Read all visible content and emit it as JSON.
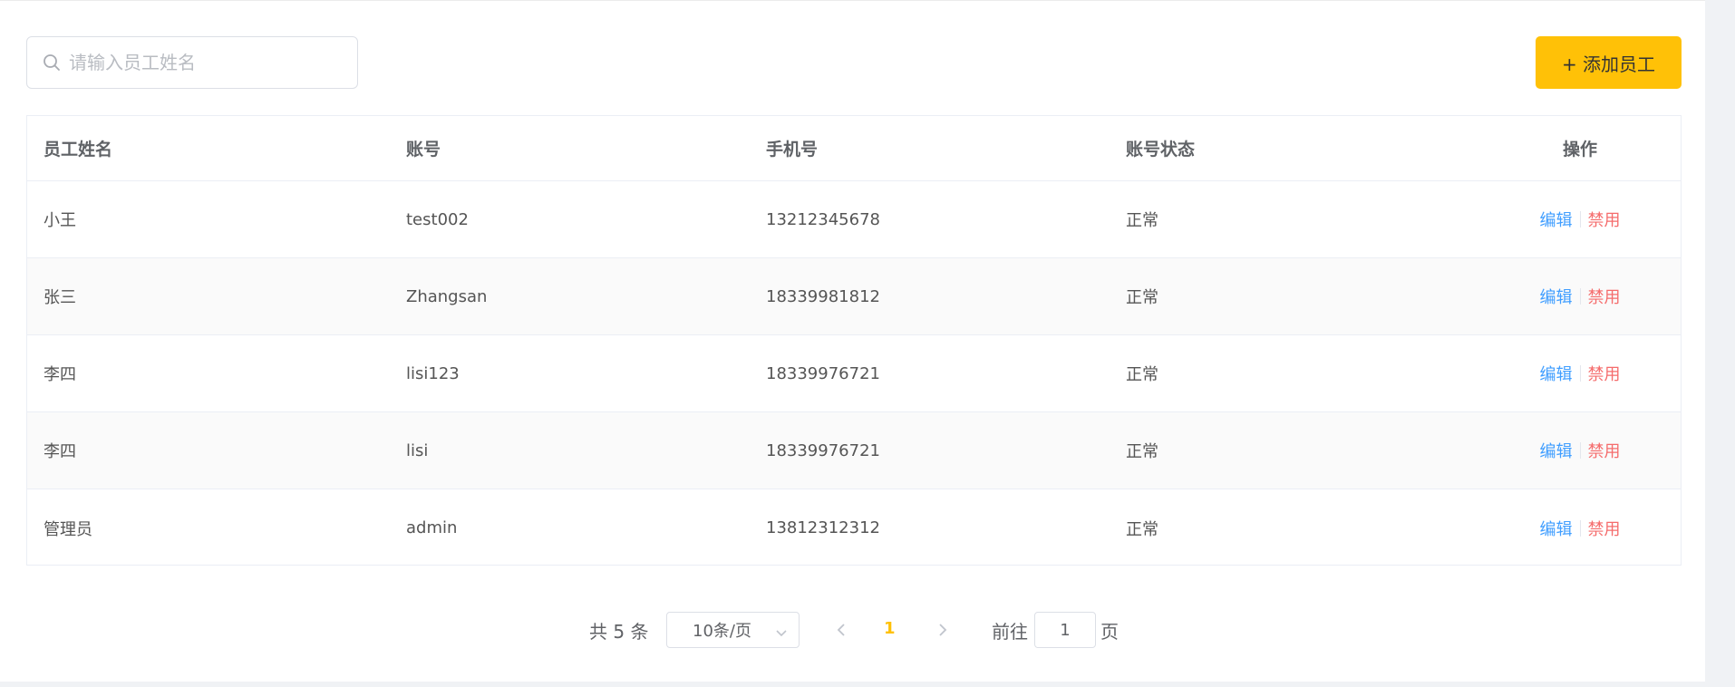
{
  "toolbar": {
    "search_placeholder": "请输入员工姓名",
    "add_label": "+ 添加员工"
  },
  "table": {
    "headers": {
      "name": "员工姓名",
      "account": "账号",
      "phone": "手机号",
      "status": "账号状态",
      "ops": "操作"
    },
    "rows": [
      {
        "name": "小王",
        "account": "test002",
        "phone": "13212345678",
        "status": "正常",
        "edit": "编辑",
        "disable": "禁用"
      },
      {
        "name": "张三",
        "account": "Zhangsan",
        "phone": "18339981812",
        "status": "正常",
        "edit": "编辑",
        "disable": "禁用"
      },
      {
        "name": "李四",
        "account": "lisi123",
        "phone": "18339976721",
        "status": "正常",
        "edit": "编辑",
        "disable": "禁用"
      },
      {
        "name": "李四",
        "account": "lisi",
        "phone": "18339976721",
        "status": "正常",
        "edit": "编辑",
        "disable": "禁用"
      },
      {
        "name": "管理员",
        "account": "admin",
        "phone": "13812312312",
        "status": "正常",
        "edit": "编辑",
        "disable": "禁用"
      }
    ]
  },
  "pagination": {
    "total_label": "共 5 条",
    "page_size": "10条/页",
    "current_page": "1",
    "goto_label": "前往",
    "goto_value": "1",
    "goto_suffix": "页"
  },
  "colors": {
    "accent": "#ffc107",
    "link": "#409eff",
    "danger": "#f56c6c"
  },
  "icons": {
    "search": "search-icon",
    "dropdown": "chevron-down-icon",
    "prev": "chevron-left-icon",
    "next": "chevron-right-icon"
  }
}
